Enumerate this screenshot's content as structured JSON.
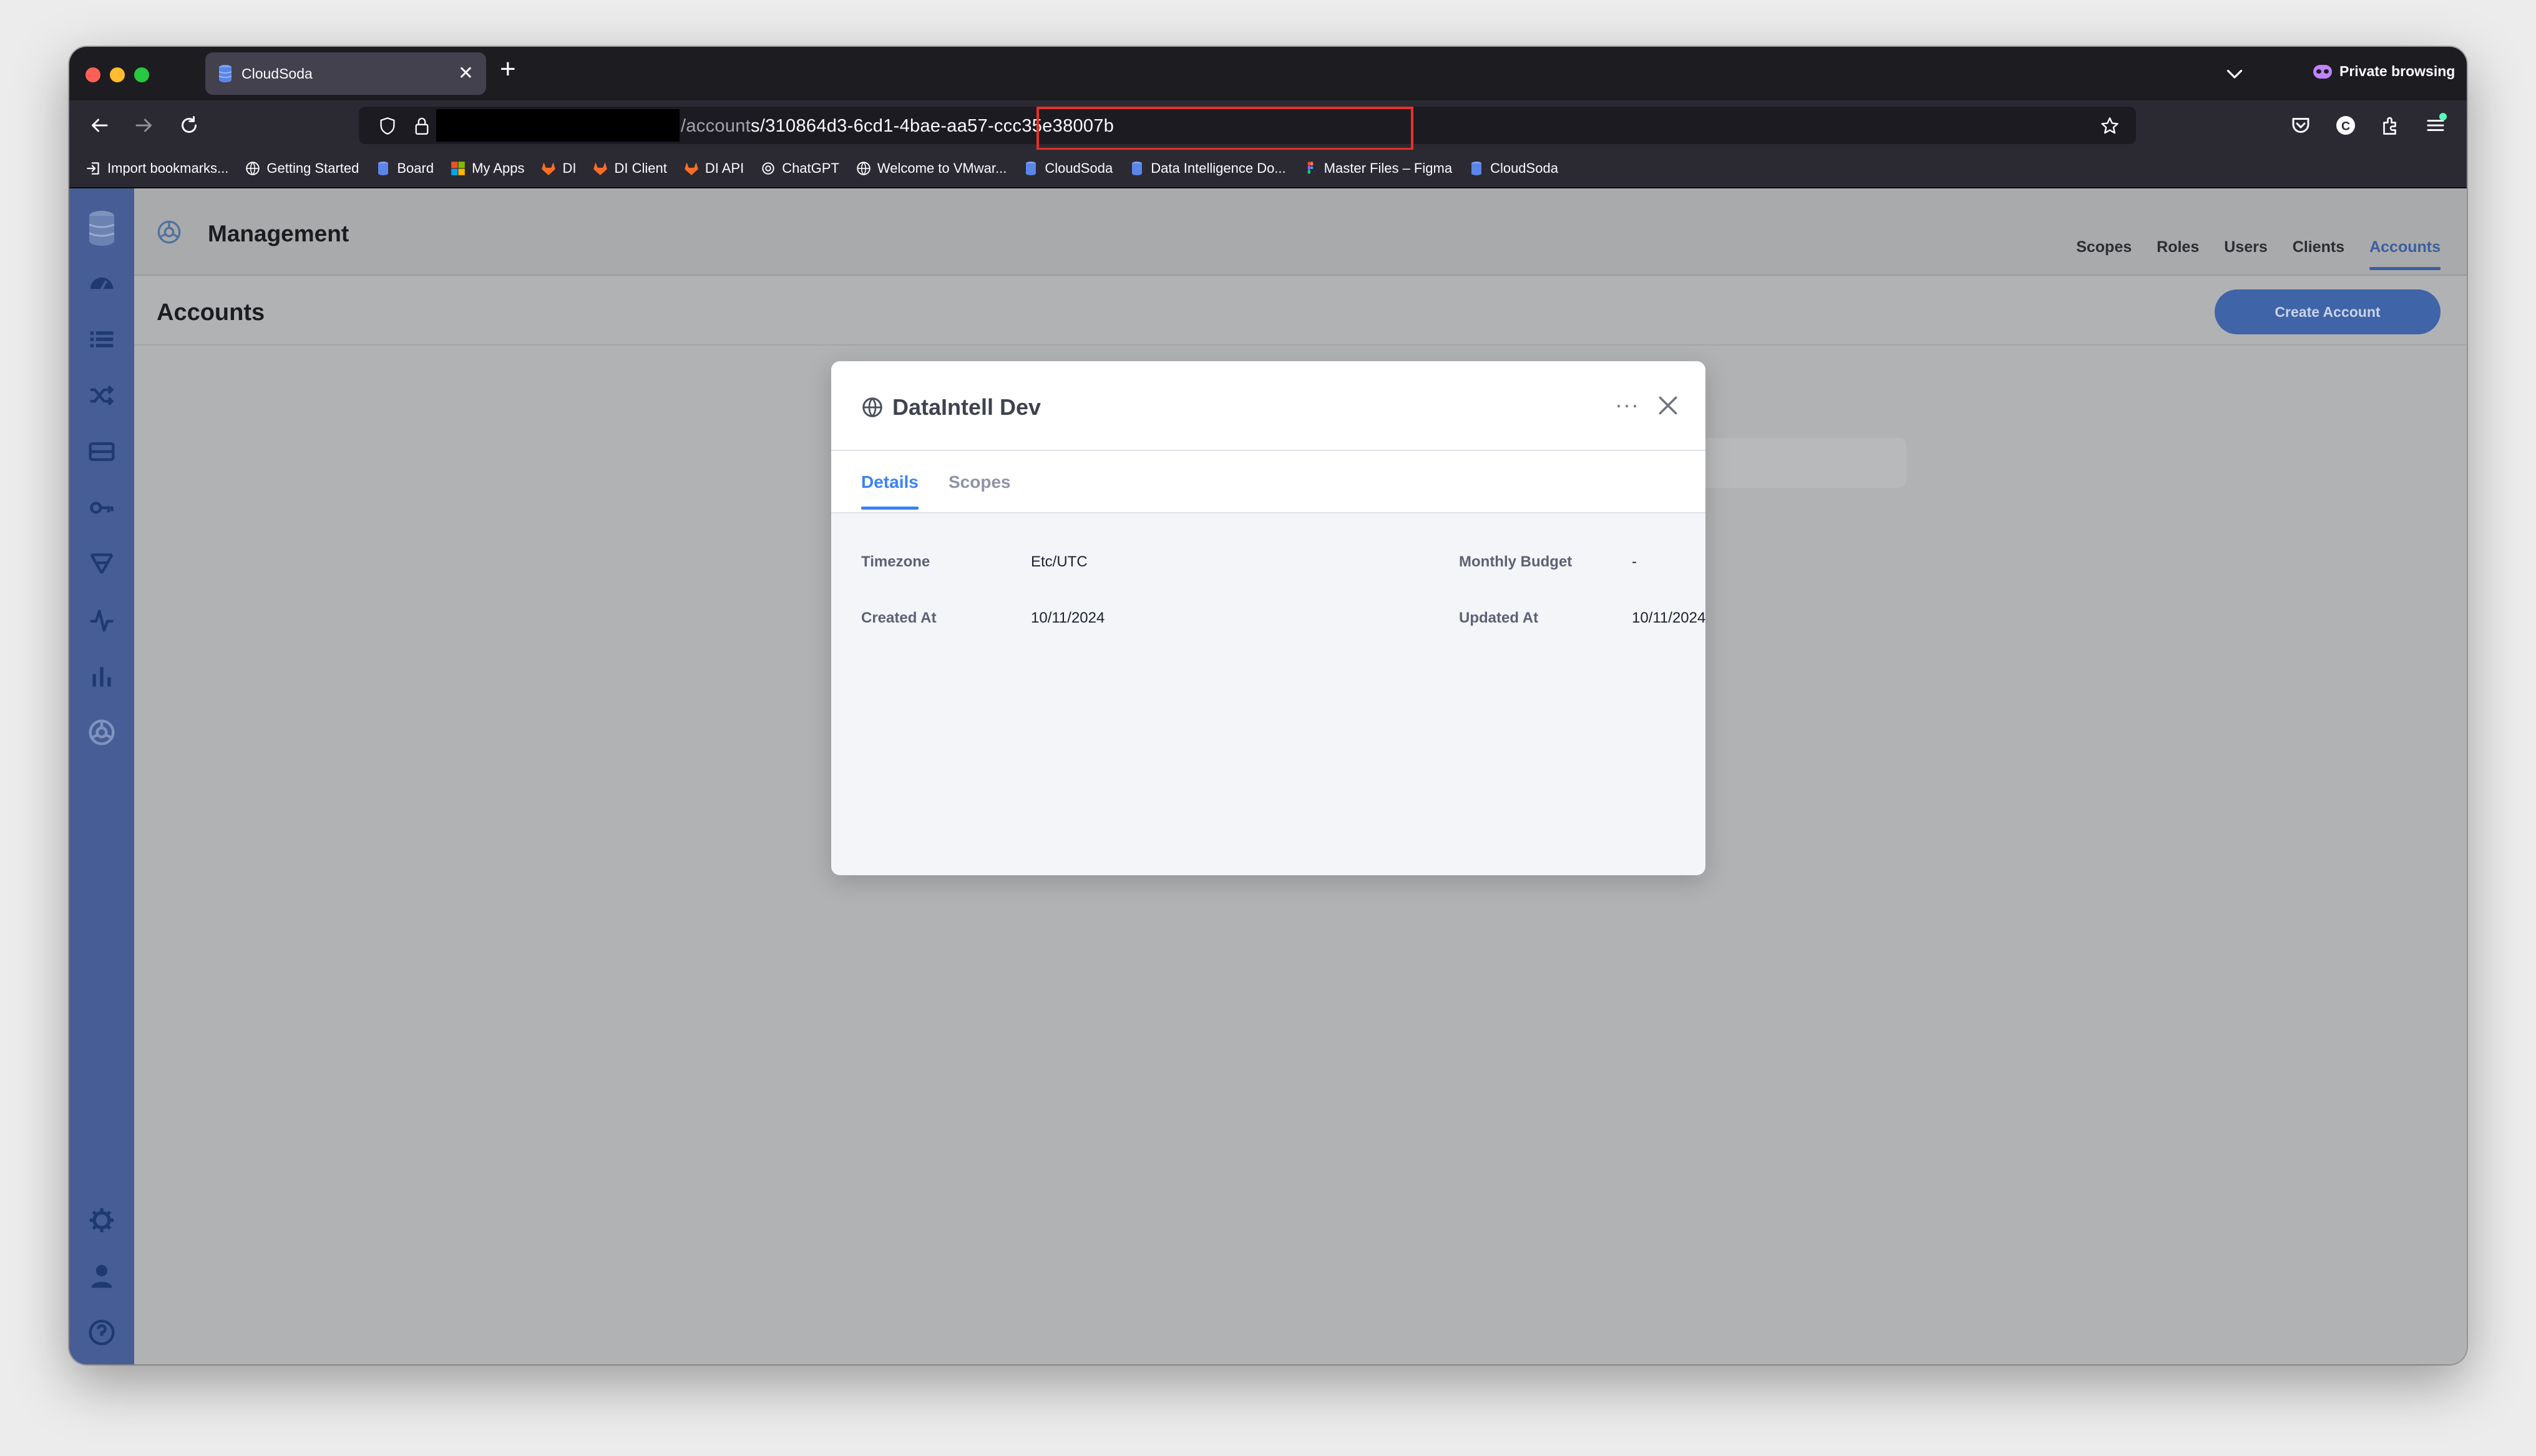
{
  "browser": {
    "tab_title": "CloudSoda",
    "new_tab": "+",
    "tab_close": "✕",
    "private_label": "Private browsing",
    "url_visible": "/accounts/310864d3-6cd1-4bae-aa57-ccc35e38007b",
    "url_prefix": "/account",
    "url_highlighted": "s/310864d3-6cd1-4bae-aa57-ccc35e38007b",
    "bookmarks": [
      {
        "label": "Import bookmarks...",
        "icon": "import-icon"
      },
      {
        "label": "Getting Started",
        "icon": "globe-icon"
      },
      {
        "label": "Board",
        "icon": "cloudsoda-icon"
      },
      {
        "label": "My Apps",
        "icon": "microsoft-icon"
      },
      {
        "label": "DI",
        "icon": "gitlab-icon"
      },
      {
        "label": "DI Client",
        "icon": "gitlab-icon"
      },
      {
        "label": "DI API",
        "icon": "gitlab-icon"
      },
      {
        "label": "ChatGPT",
        "icon": "openai-icon"
      },
      {
        "label": "Welcome to VMwar...",
        "icon": "globe-icon"
      },
      {
        "label": "CloudSoda",
        "icon": "cloudsoda-icon"
      },
      {
        "label": "Data Intelligence Do...",
        "icon": "cloudsoda-icon"
      },
      {
        "label": "Master Files – Figma",
        "icon": "figma-icon"
      },
      {
        "label": "CloudSoda",
        "icon": "cloudsoda-icon"
      }
    ]
  },
  "app": {
    "section_title": "Management",
    "page_title": "Accounts",
    "nav": [
      "Scopes",
      "Roles",
      "Users",
      "Clients",
      "Accounts"
    ],
    "active_nav": "Accounts",
    "create_button": "Create Account",
    "sidebar_icons": [
      "database-icon",
      "dashboard-icon",
      "list-icon",
      "shuffle-icon",
      "storage-icon",
      "key-icon",
      "workflow-icon",
      "activity-icon",
      "chart-icon",
      "management-icon",
      "settings-icon",
      "user-icon",
      "help-icon"
    ]
  },
  "modal": {
    "title": "DataIntell Dev",
    "more": "···",
    "tabs": [
      "Details",
      "Scopes"
    ],
    "active_tab": "Details",
    "fields": {
      "timezone_label": "Timezone",
      "timezone_value": "Etc/UTC",
      "budget_label": "Monthly Budget",
      "budget_value": "-",
      "created_label": "Created At",
      "created_value": "10/11/2024",
      "updated_label": "Updated At",
      "updated_value": "10/11/2024"
    }
  },
  "colors": {
    "sidebar": "#465e95",
    "accent": "#3b5f9e",
    "active_tab": "#3b82f6",
    "url_highlight": "#e8312a",
    "overlay": "#b1b2b4"
  }
}
